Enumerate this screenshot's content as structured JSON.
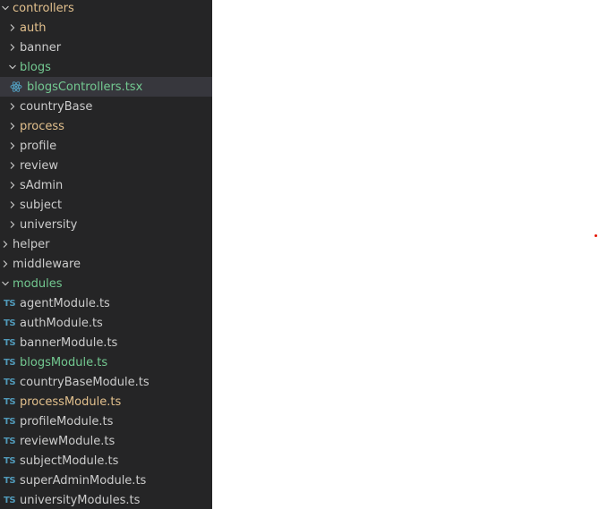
{
  "explorer": {
    "items": [
      {
        "label": "controllers",
        "kind": "folder-open",
        "status": "modified"
      },
      {
        "label": "auth",
        "kind": "folder",
        "status": "modified"
      },
      {
        "label": "banner",
        "kind": "folder",
        "status": "none"
      },
      {
        "label": "blogs",
        "kind": "folder-open",
        "status": "added"
      },
      {
        "label": "blogsControllers.tsx",
        "kind": "tsx-file",
        "icon": "react-icon",
        "status": "added",
        "selected": true
      },
      {
        "label": "countryBase",
        "kind": "folder",
        "status": "none"
      },
      {
        "label": "process",
        "kind": "folder",
        "status": "modified"
      },
      {
        "label": "profile",
        "kind": "folder",
        "status": "none"
      },
      {
        "label": "review",
        "kind": "folder",
        "status": "none"
      },
      {
        "label": "sAdmin",
        "kind": "folder",
        "status": "none"
      },
      {
        "label": "subject",
        "kind": "folder",
        "status": "none"
      },
      {
        "label": "university",
        "kind": "folder",
        "status": "none"
      },
      {
        "label": "helper",
        "kind": "folder",
        "status": "none"
      },
      {
        "label": "middleware",
        "kind": "folder",
        "status": "none"
      },
      {
        "label": "modules",
        "kind": "folder-open",
        "status": "added"
      },
      {
        "label": "agentModule.ts",
        "kind": "ts-file",
        "icon": "TS",
        "status": "none"
      },
      {
        "label": "authModule.ts",
        "kind": "ts-file",
        "icon": "TS",
        "status": "none"
      },
      {
        "label": "bannerModule.ts",
        "kind": "ts-file",
        "icon": "TS",
        "status": "none"
      },
      {
        "label": "blogsModule.ts",
        "kind": "ts-file",
        "icon": "TS",
        "status": "added"
      },
      {
        "label": "countryBaseModule.ts",
        "kind": "ts-file",
        "icon": "TS",
        "status": "none"
      },
      {
        "label": "processModule.ts",
        "kind": "ts-file",
        "icon": "TS",
        "status": "modified"
      },
      {
        "label": "profileModule.ts",
        "kind": "ts-file",
        "icon": "TS",
        "status": "none"
      },
      {
        "label": "reviewModule.ts",
        "kind": "ts-file",
        "icon": "TS",
        "status": "none"
      },
      {
        "label": "subjectModule.ts",
        "kind": "ts-file",
        "icon": "TS",
        "status": "none"
      },
      {
        "label": "superAdminModule.ts",
        "kind": "ts-file",
        "icon": "TS",
        "status": "none"
      },
      {
        "label": "universityModules.ts",
        "kind": "ts-file",
        "icon": "TS",
        "status": "none"
      }
    ]
  },
  "colors": {
    "sidebar_bg": "#252526",
    "selected_bg": "#37373d",
    "text_default": "#cccccc",
    "git_modified": "#e2c08d",
    "git_added": "#73c991",
    "ts_icon": "#519aba",
    "react_icon": "#519aba",
    "editor_bg": "#ffffff",
    "marker": "#e51400"
  }
}
